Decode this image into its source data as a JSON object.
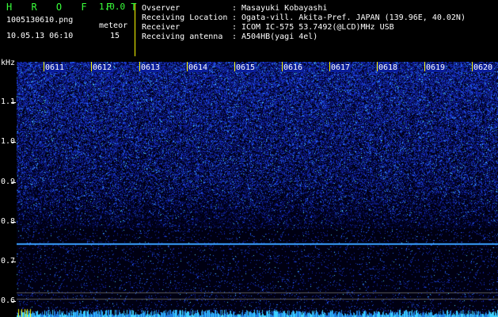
{
  "header": {
    "app_title": "H R O F F T",
    "app_version": "1.0.0",
    "file_name": "1005130610.png",
    "datetime": "10.05.13 06:10",
    "meteor_label": "meteor",
    "meteor_count": "15",
    "info": [
      {
        "label": "Ovserver",
        "value": "Masayuki Kobayashi"
      },
      {
        "label": "Receiving Location",
        "value": "Ogata-vill. Akita-Pref. JAPAN (139.96E, 40.02N)"
      },
      {
        "label": "Receiver",
        "value": "ICOM IC-575 53.7492(@LCD)MHz USB"
      },
      {
        "label": "Receiving antenna",
        "value": "A504HB(yagi 4el)"
      }
    ],
    "colon": ":"
  },
  "axis": {
    "y_unit": "kHz",
    "y_labels": [
      "1.1",
      "1.0",
      "0.9",
      "0.8",
      "0.7",
      "0.6"
    ],
    "x_labels": [
      "0611",
      "0612",
      "0613",
      "0614",
      "0615",
      "0616",
      "0617",
      "0618",
      "0619",
      "0620"
    ]
  },
  "colors": {
    "signal": "#2f5cff",
    "background": "#000000",
    "carrier_line": "#3aa0ff",
    "title": "#39ff3b",
    "divider": "#ffff00"
  }
}
